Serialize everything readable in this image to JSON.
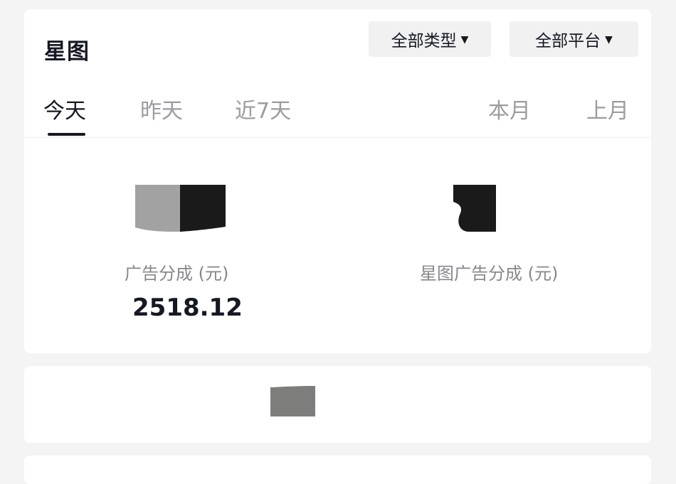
{
  "section": {
    "title": "星图"
  },
  "filters": {
    "type_label": "全部类型",
    "platform_label": "全部平台",
    "caret_icon": "caret-down-icon"
  },
  "tabs": [
    {
      "label": "今天",
      "active": true
    },
    {
      "label": "昨天",
      "active": false
    },
    {
      "label": "近7天",
      "active": false
    },
    {
      "label": "本月",
      "active": false
    },
    {
      "label": "上月",
      "active": false
    }
  ],
  "stats": [
    {
      "label": "广告分成 (元)",
      "value": "2518.12"
    },
    {
      "label": "星图广告分成 (元)",
      "value": ""
    }
  ],
  "colors": {
    "card_background": "#ffffff",
    "page_background": "#f4f4f4",
    "text_primary": "#161823",
    "text_secondary": "#86878c",
    "tab_inactive": "#9b9ba1",
    "filter_background": "#f1f1f2"
  }
}
